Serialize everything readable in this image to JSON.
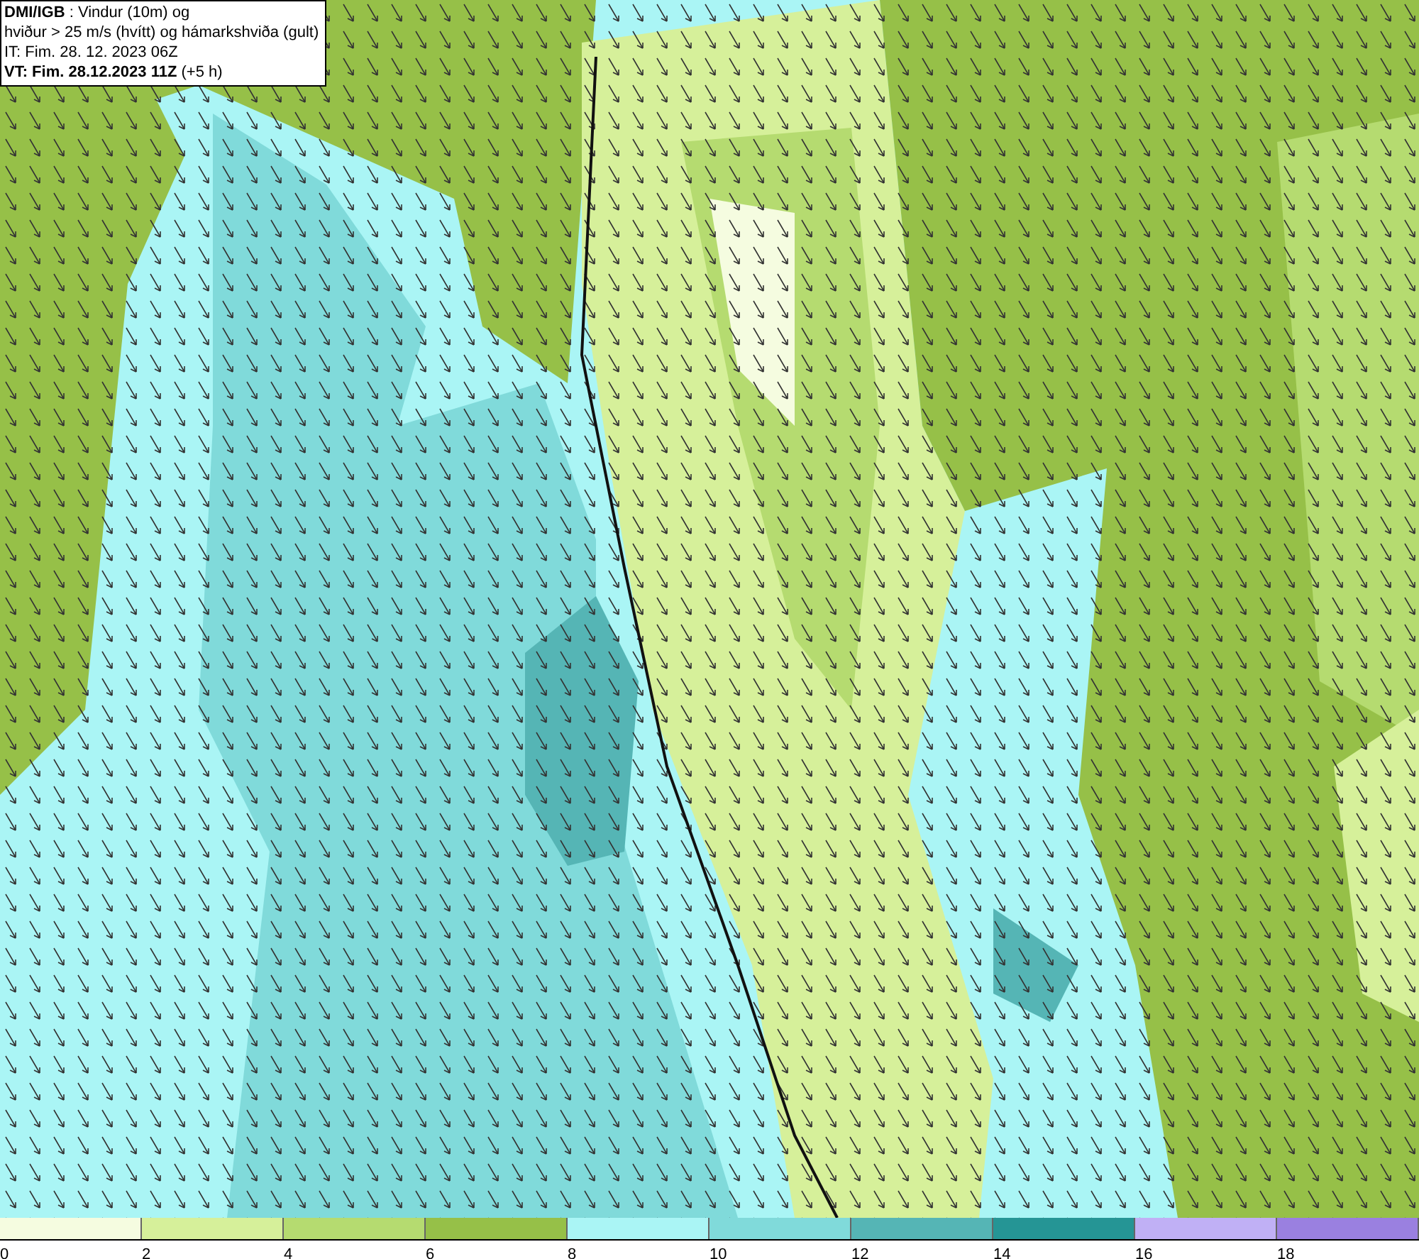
{
  "legend": {
    "lines": [
      "**DMI/IGB** : Vindur (10m) og",
      "hviður > 25 m/s (hvítt) og hámarkshviða (gult)",
      "IT: Fim. 28. 12. 2023 06Z",
      "**VT: Fim. 28.12.2023 11Z** (+5 h)"
    ]
  },
  "colorbar": [
    {
      "color": "#f5fce0",
      "tick": "0"
    },
    {
      "color": "#d6f09a",
      "tick": "2"
    },
    {
      "color": "#b5db70",
      "tick": "4"
    },
    {
      "color": "#96c048",
      "tick": "6"
    },
    {
      "color": "#aaf5f5",
      "tick": "8"
    },
    {
      "color": "#80dada",
      "tick": "10"
    },
    {
      "color": "#55b5b5",
      "tick": "12"
    },
    {
      "color": "#259595",
      "tick": "14"
    },
    {
      "color": "#c0b0f5",
      "tick": "16"
    },
    {
      "color": "#9a80e0",
      "tick": "18"
    }
  ]
}
